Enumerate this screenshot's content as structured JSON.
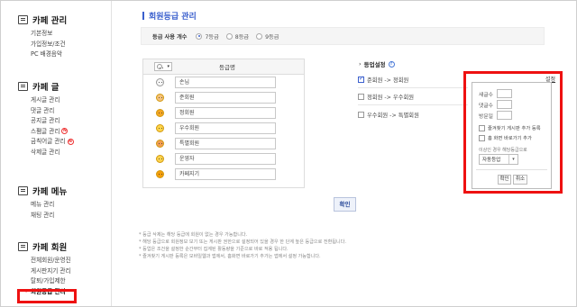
{
  "colors": {
    "accent": "#3a5fcd",
    "highlight": "#ee1111"
  },
  "sidebar": {
    "sections": [
      {
        "icon": "cafe-manage-icon",
        "title": "카페 관리",
        "items": [
          {
            "label": "기본정보"
          },
          {
            "label": "가입정보/조건"
          },
          {
            "label": "PC 배경음악"
          }
        ]
      },
      {
        "icon": "post-icon",
        "title": "카페 글",
        "items": [
          {
            "label": "게시글 관리"
          },
          {
            "label": "댓글 관리"
          },
          {
            "label": "공지글 관리"
          },
          {
            "label": "스팸글 관리",
            "badge": "N"
          },
          {
            "label": "금칙어글 관리",
            "badge": "N"
          },
          {
            "label": "삭제글 관리"
          }
        ]
      },
      {
        "icon": "menu-icon",
        "title": "카페 메뉴",
        "items": [
          {
            "label": "메뉴 관리"
          },
          {
            "label": "채팅 관리"
          }
        ]
      },
      {
        "icon": "member-icon",
        "title": "카페 회원",
        "items": [
          {
            "label": "전체회원/운영진"
          },
          {
            "label": "게시판지기 관리"
          },
          {
            "label": "탈퇴/가입제한"
          },
          {
            "label": "회원등급 관리",
            "active": true
          }
        ]
      }
    ]
  },
  "page": {
    "title": "회원등급 관리"
  },
  "grade_count": {
    "label": "등급 사용 개수",
    "options": [
      {
        "label": "7등급",
        "selected": true
      },
      {
        "label": "8등급",
        "selected": false
      },
      {
        "label": "9등급",
        "selected": false
      }
    ]
  },
  "grade_table": {
    "icon_select_caret": "▾",
    "column": "등급명",
    "rows": [
      "손님",
      "준회원",
      "정회원",
      "우수회원",
      "특별회원",
      "운영자",
      "카페지기"
    ]
  },
  "promotion": {
    "title": "등업설정",
    "help": "?",
    "rows": [
      {
        "label": "준회원 -> 정회원",
        "checked": true
      },
      {
        "label": "정회원 -> 우수회원",
        "checked": false
      },
      {
        "label": "우수회원 -> 특별회원",
        "checked": false
      }
    ]
  },
  "settings_panel": {
    "link": "설정",
    "fields": [
      "새글수",
      "댓글수",
      "방문일"
    ],
    "checks": [
      "즐겨찾기 게시판 추가 등록",
      "홈 화면 바로가기 추가"
    ],
    "note": "이상인 경우 해당등급으로",
    "select_value": "자동등업",
    "confirm": "확인",
    "cancel": "취소"
  },
  "confirm_button": "확인",
  "notes": [
    "* 등급 삭제는 해당 등급에 회원이 없는 경우 가능합니다.",
    "* 해당 등급으로 회원정보 보기 또는 게시판 권한으로 설정되어 있을 경우 한 단계 높은 등급으로 전환됩니다.",
    "* 등업은 조건을 설정한 순간부터 집계된 활동량을 기준으로 바로 적용 됩니다.",
    "* 즐겨찾기 게시판 등록은 모바일웹과 앱에서, 홈화면 바로가기 추가는 앱에서 설정 가능합니다."
  ]
}
